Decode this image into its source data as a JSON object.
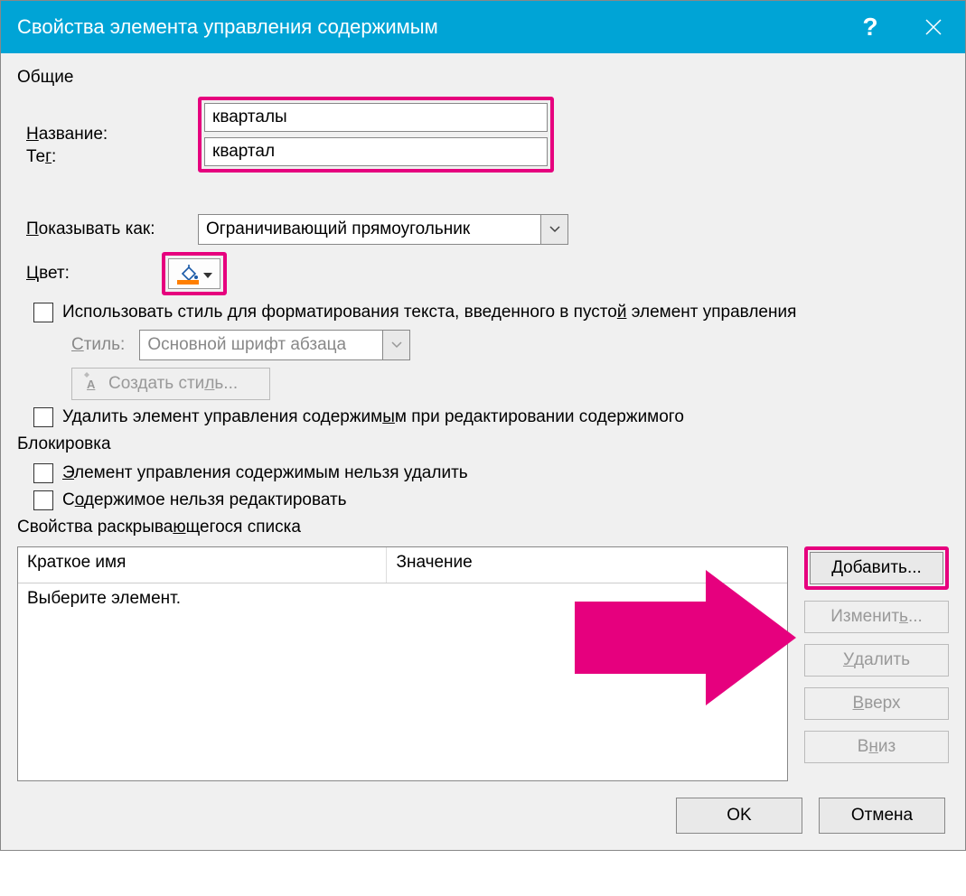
{
  "title": "Свойства элемента управления содержимым",
  "sections": {
    "general": "Общие",
    "locking": "Блокировка",
    "dropdown": "Свойства раскрывающегося списка"
  },
  "labels": {
    "name": "Название:",
    "tag": "Тег:",
    "show_as": "Показывать как:",
    "color": "Цвет:",
    "style": "Стиль:"
  },
  "values": {
    "name": "кварталы",
    "tag": "квартал",
    "show_as": "Ограничивающий прямоугольник",
    "style": "Основной шрифт абзаца"
  },
  "checkboxes": {
    "use_style": "Использовать стиль для форматирования текста, введенного в пустой элемент управления",
    "delete_on_edit": "Удалить элемент управления содержимым при редактировании содержимого",
    "cannot_delete": "Элемент управления содержимым нельзя удалить",
    "cannot_edit": "Содержимое нельзя редактировать"
  },
  "buttons": {
    "new_style": "Создать стиль...",
    "add": "Добавить...",
    "edit": "Изменить...",
    "delete": "Удалить",
    "up": "Вверх",
    "down": "Вниз",
    "ok": "OK",
    "cancel": "Отмена"
  },
  "list": {
    "col1": "Краткое имя",
    "col2": "Значение",
    "placeholder": "Выберите элемент."
  }
}
